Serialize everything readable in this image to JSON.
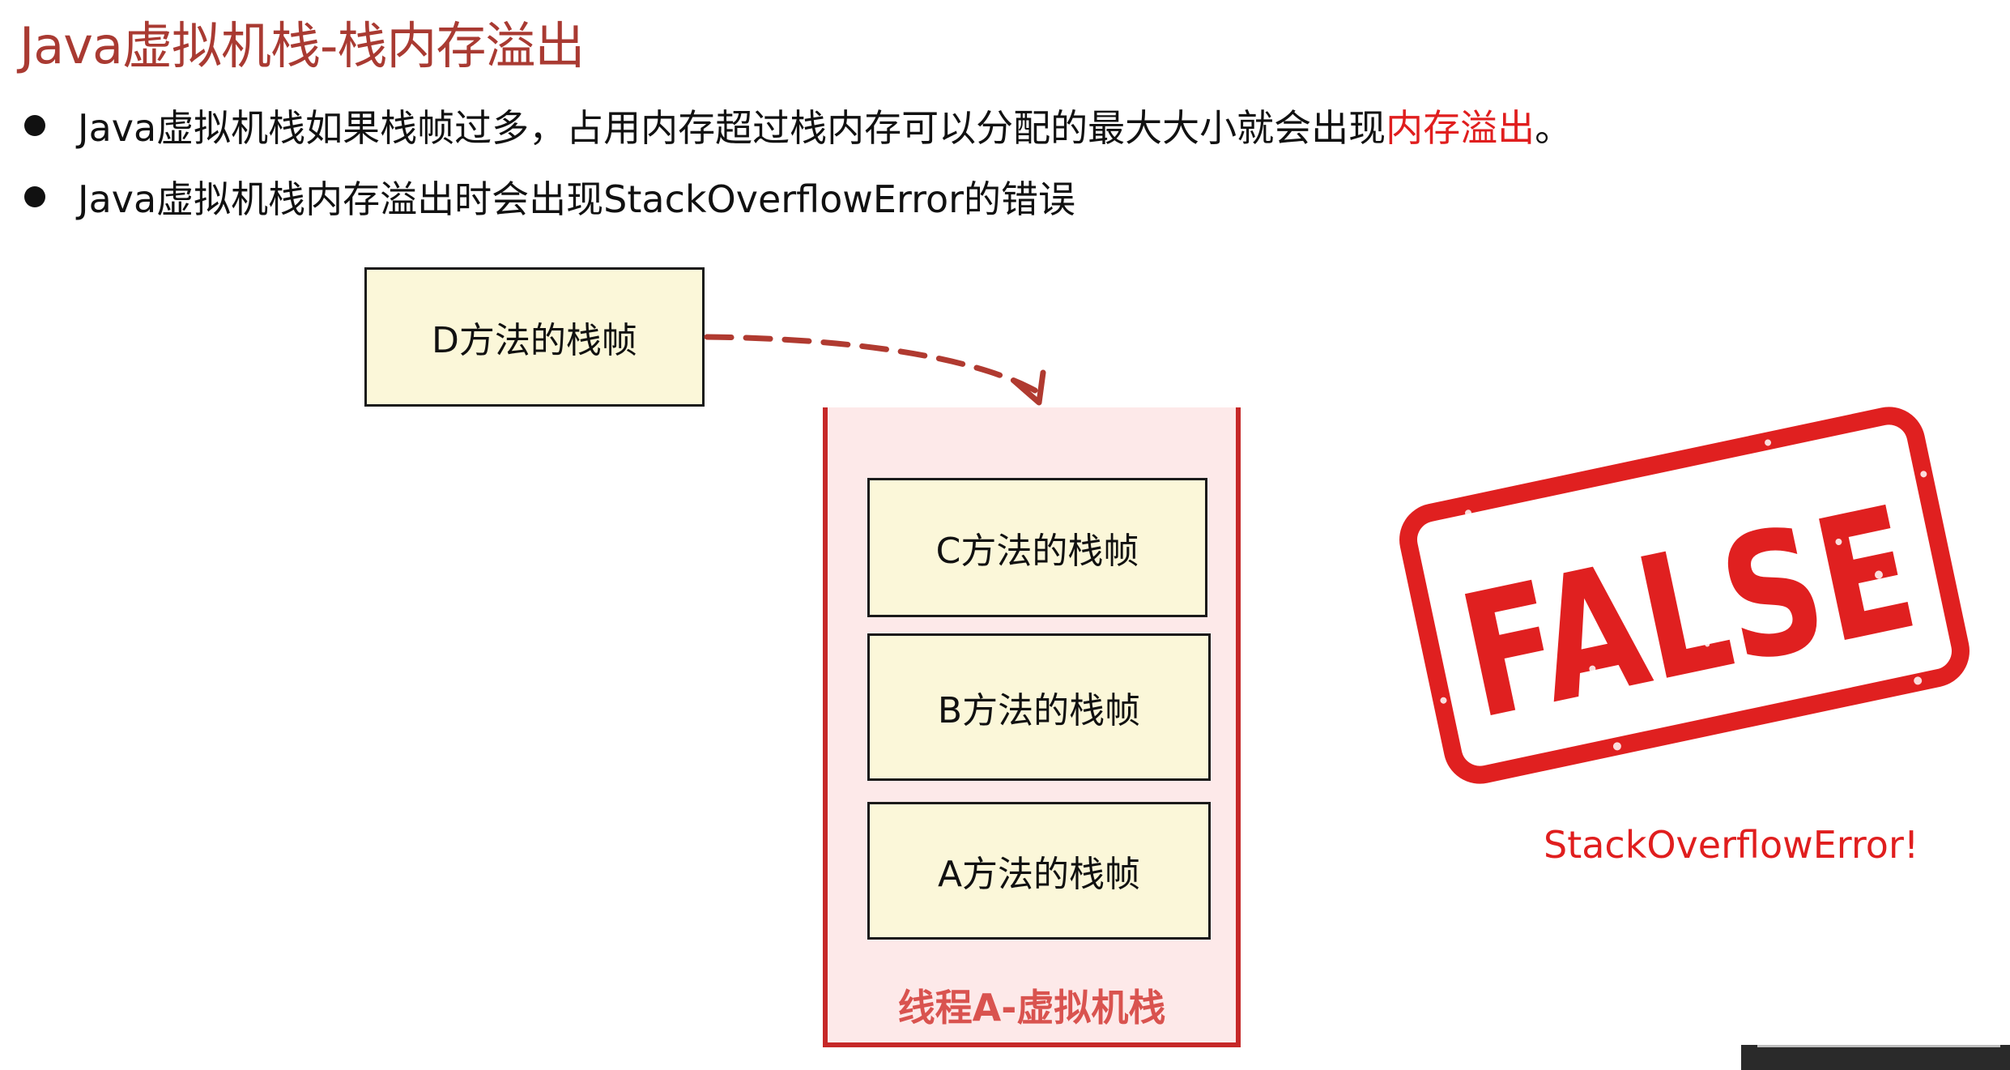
{
  "slide": {
    "title": "Java虚拟机栈-栈内存溢出",
    "bullets": [
      {
        "text_before": "Java虚拟机栈如果栈帧过多，占用内存超过栈内存可以分配的最大大小就会出现",
        "highlight": "内存溢出",
        "text_after": "。"
      },
      {
        "text": "Java虚拟机栈内存溢出时会出现StackOverflowError的错误"
      }
    ]
  },
  "diagram": {
    "incoming_frame": "D方法的栈帧",
    "stack_frames": [
      "C方法的栈帧",
      "B方法的栈帧",
      "A方法的栈帧"
    ],
    "stack_label": "线程A-虚拟机栈"
  },
  "stamp": {
    "word": "FALSE",
    "error": "StackOverflowError!"
  },
  "colors": {
    "title": "#a93a32",
    "highlight": "#e01e1e",
    "stack_border": "#c62828",
    "stack_fill": "#fde9e9",
    "frame_fill": "#fbf7d9",
    "stamp_red": "#e02020"
  }
}
